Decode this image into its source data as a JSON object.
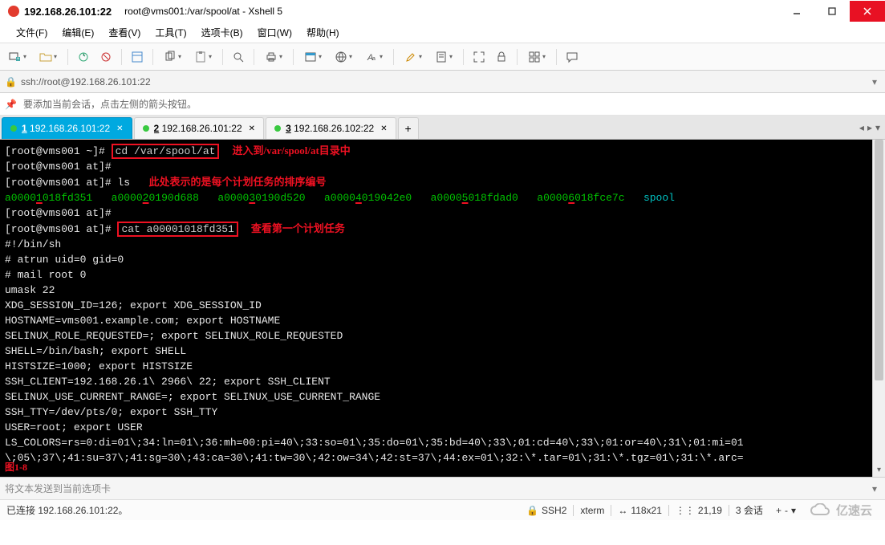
{
  "title": {
    "host_port": "192.168.26.101:22",
    "session": "root@vms001:/var/spool/at - Xshell 5"
  },
  "menu": {
    "file": "文件(F)",
    "edit": "编辑(E)",
    "view": "查看(V)",
    "tools": "工具(T)",
    "tabcard": "选项卡(B)",
    "window": "窗口(W)",
    "help": "帮助(H)"
  },
  "addr": {
    "url": "ssh://root@192.168.26.101:22"
  },
  "hint": {
    "text": "要添加当前会话，点击左侧的箭头按钮。"
  },
  "tabs": [
    {
      "num": "1",
      "label": "192.168.26.101:22",
      "active": true
    },
    {
      "num": "2",
      "label": "192.168.26.101:22",
      "active": false
    },
    {
      "num": "3",
      "label": "192.168.26.102:22",
      "active": false
    }
  ],
  "term": {
    "prompt1": "[root@vms001 ~]# ",
    "cd_cmd": "cd /var/spool/at",
    "annot_cd": "进入到/var/spool/at目录中",
    "prompt2": "[root@vms001 at]#",
    "ls_cmd": "[root@vms001 at]# ls",
    "annot_ls": "此处表示的是每个计划任务的排序编号",
    "files": {
      "f1a": "a0000",
      "f1b": "1",
      "f1c": "018fd351",
      "f2a": "a0000",
      "f2b": "2",
      "f2c": "0190d688",
      "f3a": "a0000",
      "f3b": "3",
      "f3c": "0190d520",
      "f4a": "a0000",
      "f4b": "4",
      "f4c": "019042e0",
      "f5a": "a0000",
      "f5b": "5",
      "f5c": "018fdad0",
      "f6a": "a0000",
      "f6b": "6",
      "f6c": "018fce7c",
      "spool": "spool"
    },
    "prompt3": "[root@vms001 at]#",
    "cat_prefix": "[root@vms001 at]# ",
    "cat_cmd": "cat a00001018fd351",
    "annot_cat": "查看第一个计划任务",
    "body": "#!/bin/sh\n# atrun uid=0 gid=0\n# mail root 0\numask 22\nXDG_SESSION_ID=126; export XDG_SESSION_ID\nHOSTNAME=vms001.example.com; export HOSTNAME\nSELINUX_ROLE_REQUESTED=; export SELINUX_ROLE_REQUESTED\nSHELL=/bin/bash; export SHELL\nHISTSIZE=1000; export HISTSIZE\nSSH_CLIENT=192.168.26.1\\ 2966\\ 22; export SSH_CLIENT\nSELINUX_USE_CURRENT_RANGE=; export SELINUX_USE_CURRENT_RANGE\nSSH_TTY=/dev/pts/0; export SSH_TTY\nUSER=root; export USER\nLS_COLORS=rs=0:di=01\\;34:ln=01\\;36:mh=00:pi=40\\;33:so=01\\;35:do=01\\;35:bd=40\\;33\\;01:cd=40\\;33\\;01:or=40\\;31\\;01:mi=01\n\\;05\\;37\\;41:su=37\\;41:sg=30\\;43:ca=30\\;41:tw=30\\;42:ow=34\\;42:st=37\\;44:ex=01\\;32:\\*.tar=01\\;31:\\*.tgz=01\\;31:\\*.arc=",
    "fig_label": "图1-8"
  },
  "send": {
    "placeholder": "将文本发送到当前选项卡"
  },
  "status": {
    "connected": "已连接 192.168.26.101:22。",
    "proto": "SSH2",
    "term": "xterm",
    "size": "118x21",
    "cursor": "21,19",
    "sessions": "3 会话",
    "brand": "亿速云"
  }
}
